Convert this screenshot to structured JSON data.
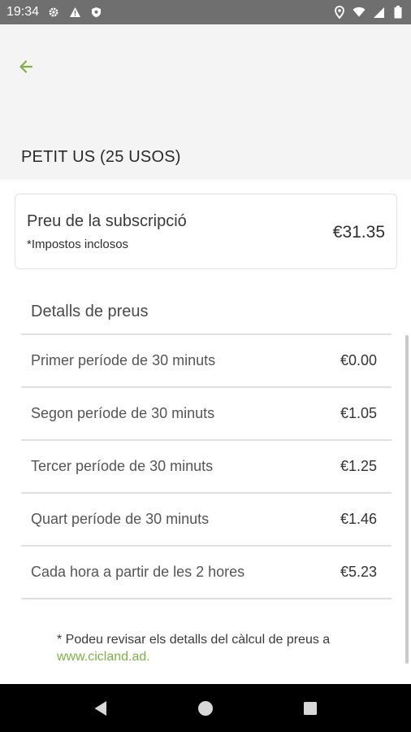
{
  "status_bar": {
    "time": "19:34",
    "icons_left": [
      "settings-icon",
      "warning-icon",
      "shield-icon"
    ],
    "icons_right": [
      "location-icon",
      "wifi-icon",
      "signal-icon",
      "battery-icon"
    ]
  },
  "header": {
    "back_icon": "arrow-back-icon",
    "plan_title": "PETIT US (25 USOS)"
  },
  "subscription": {
    "label": "Preu de la subscripció",
    "sublabel": "*Impostos inclosos",
    "price": "€31.35"
  },
  "details": {
    "title": "Detalls de preus",
    "rows": [
      {
        "label": "Primer període de 30 minuts",
        "price": "€0.00"
      },
      {
        "label": "Segon període de 30 minuts",
        "price": "€1.05"
      },
      {
        "label": "Tercer període de 30 minuts",
        "price": "€1.25"
      },
      {
        "label": "Quart període de 30 minuts",
        "price": "€1.46"
      },
      {
        "label": "Cada hora a partir de les 2 hores",
        "price": "€5.23"
      }
    ]
  },
  "footnote": {
    "text": "* Podeu revisar els detalls del càlcul de preus a",
    "link": "www.cicland.ad."
  },
  "colors": {
    "accent": "#7cb342",
    "status_bar": "#6f6f6f",
    "header_bg": "#f4f4f4"
  },
  "nav_bar": {
    "icons": [
      "back-triangle-icon",
      "home-circle-icon",
      "recents-square-icon"
    ]
  }
}
